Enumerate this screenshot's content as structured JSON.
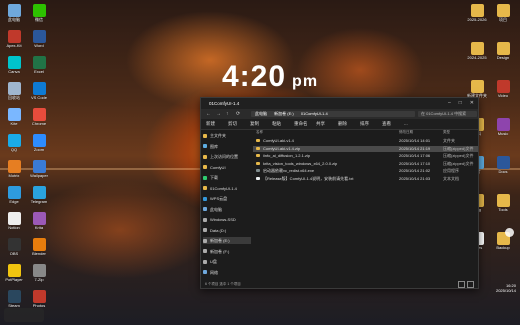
{
  "clock": {
    "time": "4:20",
    "ampm": "pm"
  },
  "desktop_left": [
    {
      "label": "此电脑",
      "icon": "computer-icon",
      "color": "#6fa8dc"
    },
    {
      "label": "Apex-Kit",
      "icon": "app-icon",
      "color": "#c0392b"
    },
    {
      "label": "Canva",
      "icon": "app-icon",
      "color": "#00c4cc"
    },
    {
      "label": "回收站",
      "icon": "recycle-bin-icon",
      "color": "#9fb6cf"
    },
    {
      "label": "Kite",
      "icon": "app-icon",
      "color": "#7ab7ff"
    },
    {
      "label": "QQ",
      "icon": "qq-icon",
      "color": "#1aabe8"
    },
    {
      "label": "Motrix",
      "icon": "download-icon",
      "color": "#e67e22"
    },
    {
      "label": "Edge",
      "icon": "edge-icon",
      "color": "#2e9bde"
    },
    {
      "label": "Notion",
      "icon": "notion-icon",
      "color": "#eeeeee"
    },
    {
      "label": "OBS",
      "icon": "obs-icon",
      "color": "#333333"
    },
    {
      "label": "PotPlayer",
      "icon": "video-icon",
      "color": "#f1c40f"
    },
    {
      "label": "Steam",
      "icon": "steam-icon",
      "color": "#2a475e"
    },
    {
      "label": "微信",
      "icon": "wechat-icon",
      "color": "#2dc100"
    },
    {
      "label": "Word",
      "icon": "word-icon",
      "color": "#2b579a"
    },
    {
      "label": "Excel",
      "icon": "excel-icon",
      "color": "#217346"
    },
    {
      "label": "VS Code",
      "icon": "code-icon",
      "color": "#0e7ad3"
    },
    {
      "label": "Chrome",
      "icon": "chrome-icon",
      "color": "#e74c3c"
    },
    {
      "label": "Zoom",
      "icon": "zoom-icon",
      "color": "#2d8cff"
    },
    {
      "label": "Wallpaper",
      "icon": "wallpaper-icon",
      "color": "#3a7bd5"
    },
    {
      "label": "Telegram",
      "icon": "telegram-icon",
      "color": "#2aa3de"
    },
    {
      "label": "Krita",
      "icon": "paint-icon",
      "color": "#9b59b6"
    },
    {
      "label": "Blender",
      "icon": "blender-icon",
      "color": "#e87d0d"
    },
    {
      "label": "7-Zip",
      "icon": "zip-icon",
      "color": "#888888"
    },
    {
      "label": "Photos",
      "icon": "image-icon",
      "color": "#c0392b"
    }
  ],
  "desktop_right": [
    {
      "label": "2025-2026",
      "icon": "folder-icon",
      "color": "#e6b84a"
    },
    {
      "label": "2024-2025",
      "icon": "folder-icon",
      "color": "#e6b84a"
    },
    {
      "label": "新建文件夹",
      "icon": "folder-icon",
      "color": "#e6b84a"
    },
    {
      "label": "资料",
      "icon": "folder-icon",
      "color": "#e6b84a"
    },
    {
      "label": "图片",
      "icon": "image-icon",
      "color": "#5dade2"
    },
    {
      "label": "Blog",
      "icon": "folder-icon",
      "color": "#e6b84a"
    },
    {
      "label": "Notes",
      "icon": "document-icon",
      "color": "#ffffff"
    },
    {
      "label": "项目",
      "icon": "folder-icon",
      "color": "#e6b84a"
    },
    {
      "label": "Design",
      "icon": "folder-icon",
      "color": "#e6b84a"
    },
    {
      "label": "Video",
      "icon": "video-icon",
      "color": "#c0392b"
    },
    {
      "label": "Music",
      "icon": "music-icon",
      "color": "#8e44ad"
    },
    {
      "label": "Docs",
      "icon": "document-icon",
      "color": "#2b579a"
    },
    {
      "label": "Tools",
      "icon": "folder-icon",
      "color": "#e6b84a"
    },
    {
      "label": "Backup",
      "icon": "folder-icon",
      "color": "#e6b84a"
    }
  ],
  "explorer": {
    "tab_title": "01ComfyUI-1.4",
    "address": [
      "此电脑",
      "新加卷 (E:)",
      "01ComfyUI-1.4"
    ],
    "search_placeholder": "在 01ComfyUI-1.4 中搜索",
    "toolbar": [
      "新建",
      "剪切",
      "复制",
      "粘贴",
      "重命名",
      "共享",
      "删除",
      "排序",
      "查看",
      "..."
    ],
    "sidebar": [
      {
        "label": "主文件夹",
        "color": "#e6b84a",
        "selected": false
      },
      {
        "label": "图库",
        "color": "#5dade2",
        "selected": false
      },
      {
        "label": "上次访问的位置",
        "color": "#e6b84a",
        "selected": false
      },
      {
        "label": "ComfyUI",
        "color": "#e6b84a",
        "selected": false
      },
      {
        "label": "下载",
        "color": "#2ecc71",
        "selected": false
      },
      {
        "label": "01ComfyUI-1.4",
        "color": "#e6b84a",
        "selected": false
      },
      {
        "label": "WPS云盘",
        "color": "#3498db",
        "selected": false
      },
      {
        "label": "此电脑",
        "color": "#6fa8dc",
        "selected": false
      },
      {
        "label": "Windows-SSD",
        "color": "#aaaaaa",
        "selected": false
      },
      {
        "label": "Data (D:)",
        "color": "#aaaaaa",
        "selected": false
      },
      {
        "label": "新加卷 (E:)",
        "color": "#aaaaaa",
        "selected": true
      },
      {
        "label": "新加卷 (F:)",
        "color": "#aaaaaa",
        "selected": false
      },
      {
        "label": "U盘",
        "color": "#aaaaaa",
        "selected": false
      },
      {
        "label": "网络",
        "color": "#6fa8dc",
        "selected": false
      }
    ],
    "columns": {
      "name": "名称",
      "date": "修改日期",
      "type": "类型"
    },
    "files": [
      {
        "name": "ComfyUI-aki-v1.4",
        "date": "2025/10/14 14:01",
        "type": "文件夹",
        "color": "#e6b84a",
        "selected": false
      },
      {
        "name": "ComfyUI-aki-v1.4.zip",
        "date": "2025/10/14 21:19",
        "type": "压缩(zipped)文件",
        "color": "#e6b84a",
        "selected": true
      },
      {
        "name": "iinfo_ai_diffusion_1.2.1.zip",
        "date": "2025/10/14 17:06",
        "type": "压缩(zipped)文件",
        "color": "#e6b84a",
        "selected": false
      },
      {
        "name": "krita_vision_tools_windows_x64_2.0.0.zip",
        "date": "2025/10/14 17:10",
        "type": "压缩(zipped)文件",
        "color": "#e6b84a",
        "selected": false
      },
      {
        "name": "启动器依赖vc_redist.x64.exe",
        "date": "2025/10/14 21:02",
        "type": "应用程序",
        "color": "#7f8c8d",
        "selected": false
      },
      {
        "name": "【Release版】ComfyUI-1.4说明，安装前请先看.txt",
        "date": "2025/10/14 21:03",
        "type": "文本文档",
        "color": "#ecf0f1",
        "selected": false
      }
    ],
    "status": "6 个项目  选中 1 个项目"
  },
  "tray": {
    "time": "16:20",
    "date": "2025/10/14"
  }
}
